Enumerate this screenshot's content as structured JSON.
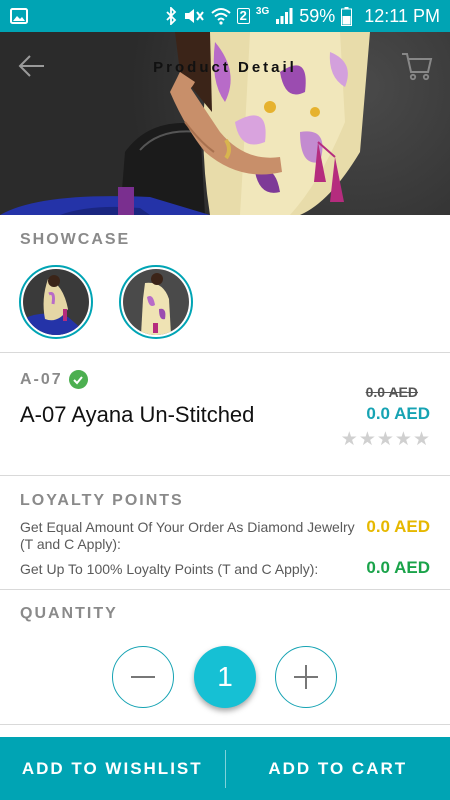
{
  "status_bar": {
    "battery": "59%",
    "time": "12:11 PM",
    "sim": "2",
    "network": "3G",
    "icons": [
      "gallery-icon",
      "bluetooth-icon",
      "mute-icon",
      "wifi-icon",
      "signal-icon",
      "battery-icon"
    ]
  },
  "header": {
    "title": "Product Detail",
    "back_icon": "arrow-left-icon",
    "cart_icon": "cart-icon"
  },
  "showcase": {
    "label": "SHOWCASE",
    "thumbnails": [
      "thumbnail-1",
      "thumbnail-2"
    ]
  },
  "product": {
    "code": "A-07",
    "name": "A-07 Ayana Un-Stitched",
    "old_price": "0.0 AED",
    "price": "0.0 AED",
    "rating": 0,
    "rating_max": 5
  },
  "loyalty": {
    "label": "LOYALTY POINTS",
    "rows": [
      {
        "text": "Get Equal Amount Of Your Order As Diamond Jewelry (T and C Apply):",
        "value": "0.0 AED",
        "color": "#e6b800"
      },
      {
        "text": "Get Up To 100% Loyalty Points (T and C Apply):",
        "value": "0.0 AED",
        "color": "#1aa34a"
      }
    ]
  },
  "quantity": {
    "label": "QUANTITY",
    "value": "1"
  },
  "actions": {
    "wishlist": "ADD TO WISHLIST",
    "cart": "ADD TO CART"
  },
  "colors": {
    "accent": "#00a4b4",
    "price": "#16a3b3"
  }
}
